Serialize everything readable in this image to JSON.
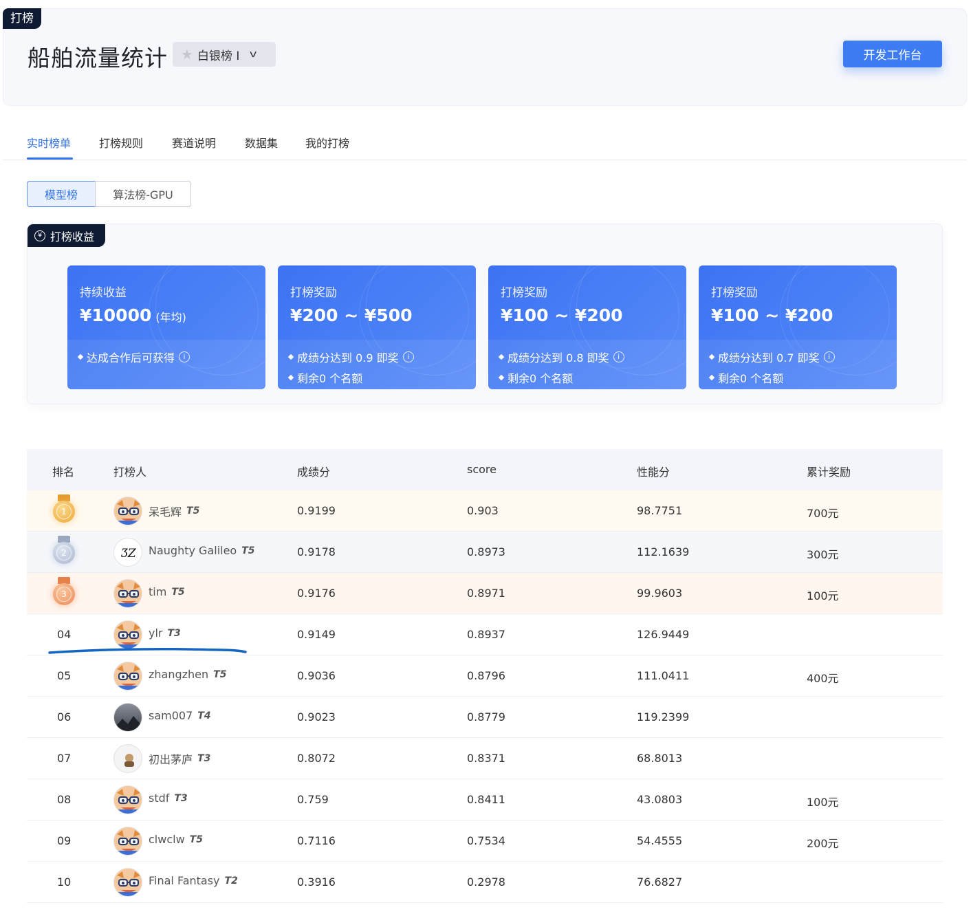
{
  "header": {
    "corner_badge": "打榜",
    "title": "船舶流量统计",
    "tier": "白银榜 I",
    "dev_button": "开发工作台"
  },
  "tabs": [
    {
      "label": "实时榜单",
      "active": true
    },
    {
      "label": "打榜规则",
      "active": false
    },
    {
      "label": "赛道说明",
      "active": false
    },
    {
      "label": "数据集",
      "active": false
    },
    {
      "label": "我的打榜",
      "active": false
    }
  ],
  "board_switch": {
    "model": "模型榜",
    "algo": "算法榜-GPU",
    "selected": "模型榜"
  },
  "earnings": {
    "badge": "打榜收益",
    "cards": [
      {
        "title": "持续收益",
        "amount": "¥10000",
        "unit": "(年均)",
        "line1": "达成合作后可获得",
        "line2": ""
      },
      {
        "title": "打榜奖励",
        "amount": "¥200 ~ ¥500",
        "unit": "",
        "line1": "成绩分达到 0.9 即奖",
        "line2": "剩余0 个名额"
      },
      {
        "title": "打榜奖励",
        "amount": "¥100 ~ ¥200",
        "unit": "",
        "line1": "成绩分达到 0.8 即奖",
        "line2": "剩余0 个名额"
      },
      {
        "title": "打榜奖励",
        "amount": "¥100 ~ ¥200",
        "unit": "",
        "line1": "成绩分达到 0.7 即奖",
        "line2": "剩余0 个名额"
      }
    ]
  },
  "table": {
    "headers": [
      "排名",
      "打榜人",
      "成绩分",
      "score",
      "性能分",
      "累计奖励"
    ],
    "rows": [
      {
        "rank": "1",
        "name": "呆毛辉",
        "level": "T5",
        "grade": "0.9199",
        "score": "0.903",
        "perf": "98.7751",
        "reward": "700元"
      },
      {
        "rank": "2",
        "name": "Naughty Galileo",
        "level": "T5",
        "grade": "0.9178",
        "score": "0.8973",
        "perf": "112.1639",
        "reward": "300元"
      },
      {
        "rank": "3",
        "name": "tim",
        "level": "T5",
        "grade": "0.9176",
        "score": "0.8971",
        "perf": "99.9603",
        "reward": "100元"
      },
      {
        "rank": "04",
        "name": "ylr",
        "level": "T3",
        "grade": "0.9149",
        "score": "0.8937",
        "perf": "126.9449",
        "reward": ""
      },
      {
        "rank": "05",
        "name": "zhangzhen",
        "level": "T5",
        "grade": "0.9036",
        "score": "0.8796",
        "perf": "111.0411",
        "reward": "400元"
      },
      {
        "rank": "06",
        "name": "sam007",
        "level": "T4",
        "grade": "0.9023",
        "score": "0.8779",
        "perf": "119.2399",
        "reward": ""
      },
      {
        "rank": "07",
        "name": "初出茅庐",
        "level": "T3",
        "grade": "0.8072",
        "score": "0.8371",
        "perf": "68.8013",
        "reward": ""
      },
      {
        "rank": "08",
        "name": "stdf",
        "level": "T3",
        "grade": "0.759",
        "score": "0.8411",
        "perf": "43.0803",
        "reward": "100元"
      },
      {
        "rank": "09",
        "name": "clwclw",
        "level": "T5",
        "grade": "0.7116",
        "score": "0.7534",
        "perf": "54.4555",
        "reward": "200元"
      },
      {
        "rank": "10",
        "name": "Final Fantasy",
        "level": "T2",
        "grade": "0.3916",
        "score": "0.2978",
        "perf": "76.6827",
        "reward": ""
      }
    ]
  },
  "colors": {
    "accent": "#3e7cf3",
    "dark_badge": "#0e1b33",
    "annotation": "#1565c0"
  }
}
